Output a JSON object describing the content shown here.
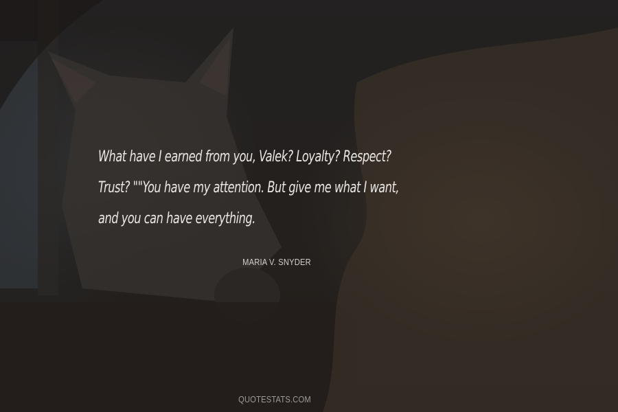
{
  "quote": {
    "lines": [
      "What have I earned from you, Valek? Loyalty? Respect?",
      "Trust? \"\"You have my attention. But give me what I want,",
      "and you can have everything."
    ],
    "author": "MARIA V. SNYDER"
  },
  "site": {
    "watermark": "QUOTESTATS.COM"
  }
}
